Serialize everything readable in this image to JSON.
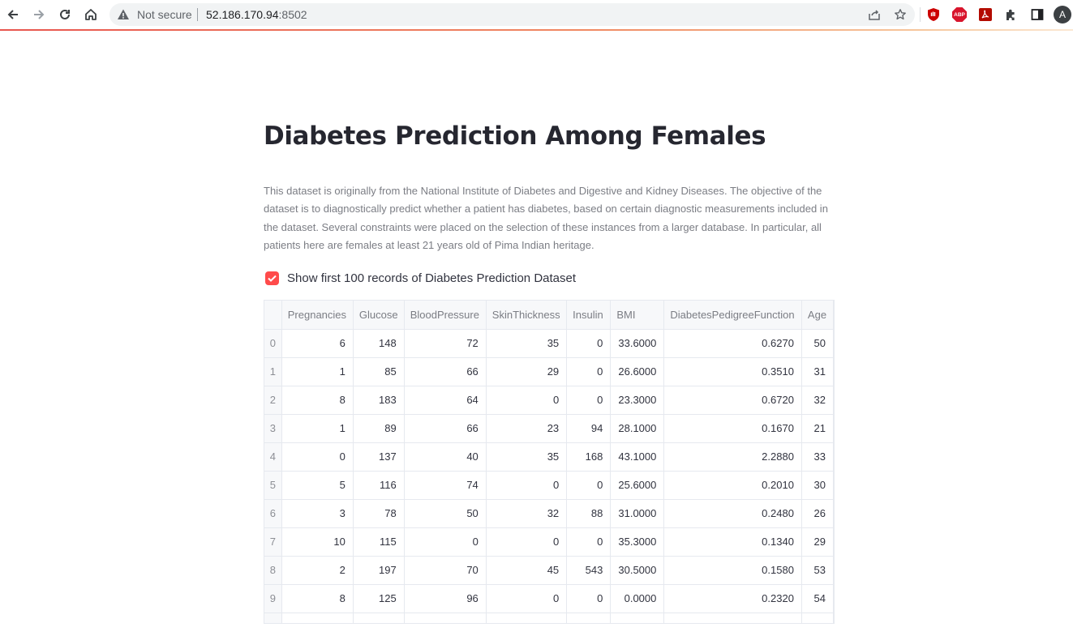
{
  "browser": {
    "security_label": "Not secure",
    "url_host": "52.186.170.94",
    "url_port": ":8502",
    "adblock_badge": "ABP",
    "profile_initial": "A"
  },
  "page": {
    "title": "Diabetes Prediction Among Females",
    "description": "This dataset is originally from the National Institute of Diabetes and Digestive and Kidney Diseases. The objective of the dataset is to diagnostically predict whether a patient has diabetes, based on certain diagnostic measurements included in the dataset. Several constraints were placed on the selection of these instances from a larger database. In particular, all patients here are females at least 21 years old of Pima Indian heritage.",
    "checkbox_label": "Show first 100 records of Diabetes Prediction Dataset",
    "checkbox_checked": true,
    "accent_color": "#ff4b4b"
  },
  "table": {
    "columns": [
      "Pregnancies",
      "Glucose",
      "BloodPressure",
      "SkinThickness",
      "Insulin",
      "BMI",
      "DiabetesPedigreeFunction",
      "Age"
    ],
    "rows": [
      {
        "index": "0",
        "cells": [
          "6",
          "148",
          "72",
          "35",
          "0",
          "33.6000",
          "0.6270",
          "50"
        ]
      },
      {
        "index": "1",
        "cells": [
          "1",
          "85",
          "66",
          "29",
          "0",
          "26.6000",
          "0.3510",
          "31"
        ]
      },
      {
        "index": "2",
        "cells": [
          "8",
          "183",
          "64",
          "0",
          "0",
          "23.3000",
          "0.6720",
          "32"
        ]
      },
      {
        "index": "3",
        "cells": [
          "1",
          "89",
          "66",
          "23",
          "94",
          "28.1000",
          "0.1670",
          "21"
        ]
      },
      {
        "index": "4",
        "cells": [
          "0",
          "137",
          "40",
          "35",
          "168",
          "43.1000",
          "2.2880",
          "33"
        ]
      },
      {
        "index": "5",
        "cells": [
          "5",
          "116",
          "74",
          "0",
          "0",
          "25.6000",
          "0.2010",
          "30"
        ]
      },
      {
        "index": "6",
        "cells": [
          "3",
          "78",
          "50",
          "32",
          "88",
          "31.0000",
          "0.2480",
          "26"
        ]
      },
      {
        "index": "7",
        "cells": [
          "10",
          "115",
          "0",
          "0",
          "0",
          "35.3000",
          "0.1340",
          "29"
        ]
      },
      {
        "index": "8",
        "cells": [
          "2",
          "197",
          "70",
          "45",
          "543",
          "30.5000",
          "0.1580",
          "53"
        ]
      },
      {
        "index": "9",
        "cells": [
          "8",
          "125",
          "96",
          "0",
          "0",
          "0.0000",
          "0.2320",
          "54"
        ]
      }
    ]
  }
}
